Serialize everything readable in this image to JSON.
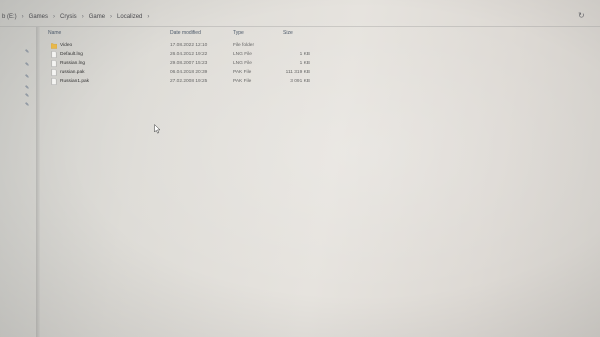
{
  "address_bar": {
    "crumbs": [
      "b (E:)",
      "Games",
      "Crysis",
      "Game",
      "Localized"
    ],
    "separator_icon": "chevron-right-icon",
    "refresh_icon": "refresh-icon"
  },
  "columns": {
    "name": "Name",
    "date_modified": "Date modified",
    "type": "Type",
    "size": "Size"
  },
  "files": [
    {
      "name": "Video",
      "date": "17.08.2022 12:10",
      "type": "File folder",
      "size": "",
      "icon": "folder-icon"
    },
    {
      "name": "Default.lng",
      "date": "26.04.2012 19:22",
      "type": "LNG File",
      "size": "1 KB",
      "icon": "file-icon"
    },
    {
      "name": "Russian.lng",
      "date": "29.08.2007 15:23",
      "type": "LNG File",
      "size": "1 KB",
      "icon": "file-icon"
    },
    {
      "name": "russian.pak",
      "date": "06.04.2018 20:39",
      "type": "PAK File",
      "size": "111 319 KB",
      "icon": "file-icon"
    },
    {
      "name": "Russian1.pak",
      "date": "27.02.2008 19:25",
      "type": "PAK File",
      "size": "3 091 KB",
      "icon": "file-icon"
    }
  ],
  "nav_pane": {
    "pin_icon": "pin-icon",
    "pin_count": 6
  },
  "colors": {
    "folder": "#e8b84a",
    "header_text": "#4d5a6a",
    "pin": "#5a6a80"
  }
}
